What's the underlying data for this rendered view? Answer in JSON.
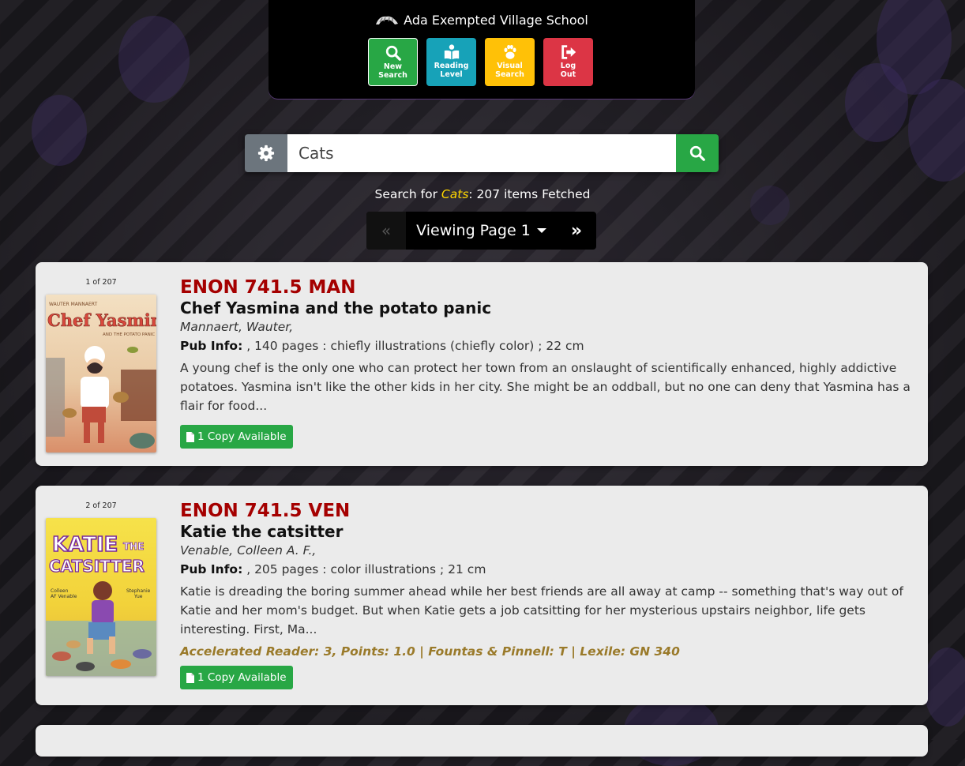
{
  "header": {
    "school_name": "Ada Exempted Village School",
    "buttons": [
      {
        "line1": "New",
        "line2": "Search",
        "icon": "search-icon"
      },
      {
        "line1": "Reading",
        "line2": "Level",
        "icon": "book-open-icon"
      },
      {
        "line1": "Visual",
        "line2": "Search",
        "icon": "paw-icon"
      },
      {
        "line1": "Log",
        "line2": "Out",
        "icon": "sign-out-icon"
      }
    ]
  },
  "search": {
    "value": "Cats",
    "results_prefix": "Search for ",
    "query": "Cats",
    "results_suffix": ": 207 items Fetched"
  },
  "pager": {
    "label": "Viewing Page 1"
  },
  "results": [
    {
      "counter": "1 of 207",
      "call_number": "ENON 741.5 MAN",
      "title": "Chef Yasmina and the potato panic",
      "author": "Mannaert, Wauter,",
      "pub_label": "Pub Info:",
      "pub_info": " , 140 pages : chiefly illustrations (chiefly color) ; 22 cm",
      "description": "A young chef is the only one who can protect her town from an onslaught of scientifically enhanced, highly addictive potatoes. Yasmina isn't like the other kids in her city. She might be an oddball, but no one can deny that Yasmina has a flair for food...",
      "reading_info": "",
      "copies": "1 Copy Available",
      "cover_text": {
        "top": "WAUTER MANNAERT",
        "title": "Chef Yasmina",
        "sub": "AND THE POTATO PANIC"
      }
    },
    {
      "counter": "2 of 207",
      "call_number": "ENON 741.5 VEN",
      "title": "Katie the catsitter",
      "author": "Venable, Colleen A. F.,",
      "pub_label": "Pub Info:",
      "pub_info": " , 205 pages : color illustrations ; 21 cm",
      "description": "Katie is dreading the boring summer ahead while her best friends are all away at camp -- something that's way out of Katie and her mom's budget. But when Katie gets a job catsitting for her mysterious upstairs neighbor, life gets interesting. First, Ma...",
      "reading_info": "Accelerated Reader: 3, Points: 1.0 | Fountas & Pinnell: T | Lexile: GN 340",
      "copies": "1 Copy Available",
      "cover_text": {
        "title1": "KATIE",
        "title2": "THE",
        "title3": "CATSITTER",
        "a1": "Colleen",
        "a2": "AF Venable",
        "b1": "Stephanie",
        "b2": "Yue"
      }
    }
  ],
  "colors": {
    "call_number": "#a50000",
    "accent_green": "#28a745",
    "info": "#17a2b8",
    "warning": "#ffc107",
    "danger": "#dc3545"
  }
}
